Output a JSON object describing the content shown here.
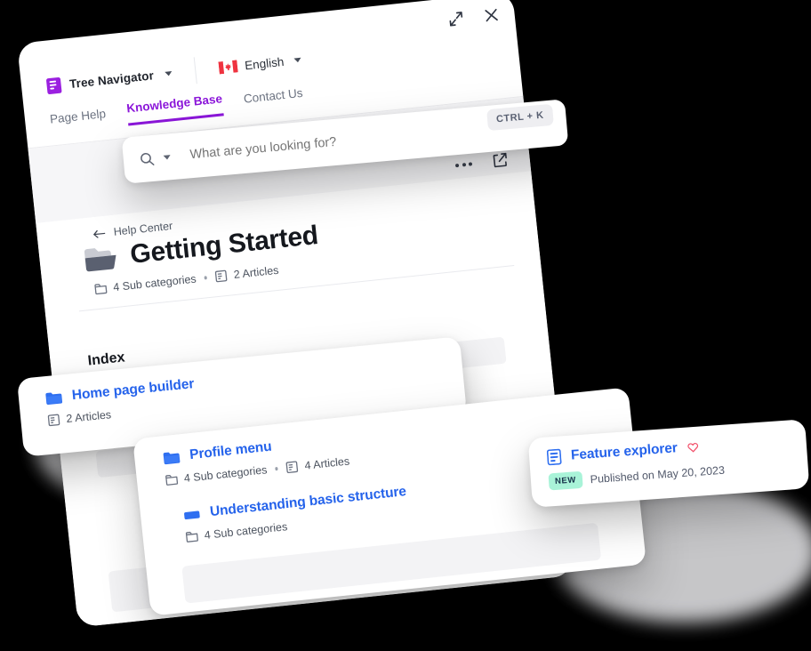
{
  "window": {
    "expand_icon": "expand-arrows-icon",
    "close_icon": "close-icon"
  },
  "brand": {
    "logo_icon": "book-icon",
    "name": "Tree Navigator",
    "caret_icon": "chevron-down-icon",
    "accent_color": "#8b16d9"
  },
  "language": {
    "flag_icon": "canada-flag-icon",
    "name": "English",
    "caret_icon": "chevron-down-icon"
  },
  "tabs": [
    {
      "label": "Page Help",
      "active": false
    },
    {
      "label": "Knowledge Base",
      "active": true
    },
    {
      "label": "Contact Us",
      "active": false
    }
  ],
  "search": {
    "icon": "search-icon",
    "caret_icon": "chevron-down-icon",
    "placeholder": "What are you looking for?",
    "value": "",
    "shortcut_hint": "CTRL + K"
  },
  "toolbar": {
    "more_icon": "ellipsis-icon",
    "open_external_icon": "external-link-icon"
  },
  "breadcrumb": {
    "back_icon": "arrow-left-icon",
    "label": "Help Center"
  },
  "page": {
    "folder_icon": "folder-open-icon",
    "title": "Getting Started",
    "meta": [
      {
        "icon": "folder-icon",
        "label": "4 Sub categories"
      },
      {
        "icon": "article-icon",
        "label": "2 Articles"
      }
    ]
  },
  "index": {
    "heading": "Index"
  },
  "cards": {
    "home_page_builder": {
      "icon": "folder-icon-blue",
      "title": "Home page builder",
      "meta": [
        {
          "icon": "article-icon",
          "label": "2 Articles"
        }
      ]
    },
    "profile_menu": {
      "icon": "folder-icon-blue",
      "title": "Profile menu",
      "meta": [
        {
          "icon": "folder-icon",
          "label": "4 Sub categories"
        },
        {
          "icon": "article-icon",
          "label": "4 Articles"
        }
      ]
    },
    "understanding_basic_structure": {
      "icon": "folder-icon-blue-closed",
      "title": "Understanding basic structure",
      "meta": [
        {
          "icon": "folder-icon",
          "label": "4 Sub categories"
        }
      ]
    },
    "feature_explorer": {
      "icon": "article-icon-blue",
      "title": "Feature explorer",
      "favorite_icon": "heart-icon",
      "badge": "NEW",
      "published": "Published on May 20, 2023",
      "badge_color": "#a9f3d8",
      "link_color": "#2563eb"
    }
  }
}
